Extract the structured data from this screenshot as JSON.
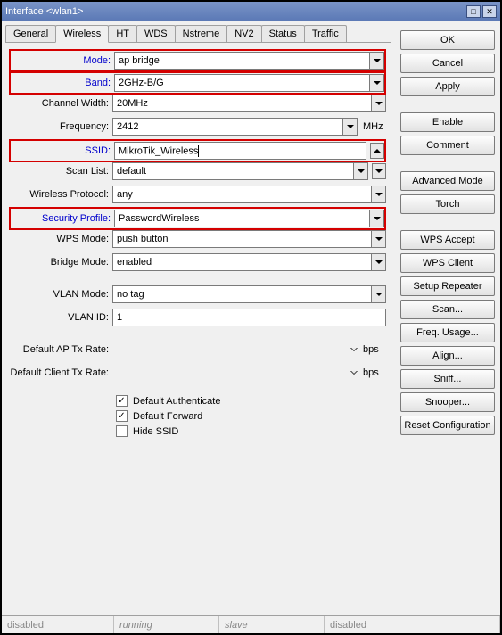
{
  "window": {
    "title": "Interface <wlan1>"
  },
  "tabs": [
    "General",
    "Wireless",
    "HT",
    "WDS",
    "Nstreme",
    "NV2",
    "Status",
    "Traffic"
  ],
  "active_tab": "Wireless",
  "fields": {
    "mode": {
      "label": "Mode:",
      "value": "ap bridge"
    },
    "band": {
      "label": "Band:",
      "value": "2GHz-B/G"
    },
    "chwidth": {
      "label": "Channel Width:",
      "value": "20MHz"
    },
    "freq": {
      "label": "Frequency:",
      "value": "2412",
      "unit": "MHz"
    },
    "ssid": {
      "label": "SSID:",
      "value": "MikroTik_Wireless"
    },
    "scanlist": {
      "label": "Scan List:",
      "value": "default"
    },
    "wproto": {
      "label": "Wireless Protocol:",
      "value": "any"
    },
    "secprof": {
      "label": "Security Profile:",
      "value": "PasswordWireless"
    },
    "wpsmode": {
      "label": "WPS Mode:",
      "value": "push button"
    },
    "brmode": {
      "label": "Bridge Mode:",
      "value": "enabled"
    },
    "vlanmode": {
      "label": "VLAN Mode:",
      "value": "no tag"
    },
    "vlanid": {
      "label": "VLAN ID:",
      "value": "1"
    },
    "defaptx": {
      "label": "Default AP Tx Rate:",
      "value": "",
      "unit": "bps"
    },
    "defcltx": {
      "label": "Default Client Tx Rate:",
      "value": "",
      "unit": "bps"
    }
  },
  "checkboxes": {
    "auth": {
      "label": "Default Authenticate",
      "checked": true
    },
    "fwd": {
      "label": "Default Forward",
      "checked": true
    },
    "hides": {
      "label": "Hide SSID",
      "checked": false
    }
  },
  "buttons": {
    "ok": "OK",
    "cancel": "Cancel",
    "apply": "Apply",
    "enable": "Enable",
    "comment": "Comment",
    "advmode": "Advanced Mode",
    "torch": "Torch",
    "wpsaccept": "WPS Accept",
    "wpsclient": "WPS Client",
    "setuprep": "Setup Repeater",
    "scan": "Scan...",
    "frequsage": "Freq. Usage...",
    "align": "Align...",
    "sniff": "Sniff...",
    "snooper": "Snooper...",
    "resetcfg": "Reset Configuration"
  },
  "statusbar": [
    "disabled",
    "running",
    "slave",
    "disabled"
  ]
}
